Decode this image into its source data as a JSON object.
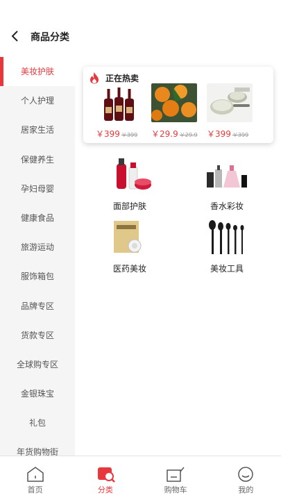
{
  "header": {
    "title": "商品分类",
    "back_icon": "chevron-left-icon"
  },
  "sidebar": {
    "active_index": 0,
    "items": [
      "美妆护肤",
      "个人护理",
      "居家生活",
      "保健养生",
      "孕妇母婴",
      "健康食品",
      "旅游运动",
      "服饰箱包",
      "品牌专区",
      "货款专区",
      "全球购专区",
      "金银珠宝",
      "礼包",
      "年货购物街"
    ]
  },
  "hot": {
    "title": "正在热卖",
    "icon": "flame-icon",
    "products": [
      {
        "price": "￥399",
        "old_price": "￥399",
        "image": "red-wine-bottles"
      },
      {
        "price": "￥29.9",
        "old_price": "￥29.9",
        "image": "oranges"
      },
      {
        "price": "￥399",
        "old_price": "￥399",
        "image": "cookware-set"
      }
    ]
  },
  "categories": [
    {
      "label": "面部护肤",
      "image": "skincare-bottles"
    },
    {
      "label": "香水彩妆",
      "image": "perfume-makeup"
    },
    {
      "label": "医药美妆",
      "image": "face-mask-pack"
    },
    {
      "label": "美妆工具",
      "image": "makeup-brushes"
    }
  ],
  "tabbar": {
    "active_index": 1,
    "items": [
      {
        "label": "首页",
        "icon": "home-icon"
      },
      {
        "label": "分类",
        "icon": "category-icon"
      },
      {
        "label": "购物车",
        "icon": "cart-icon"
      },
      {
        "label": "我的",
        "icon": "profile-icon"
      }
    ]
  },
  "colors": {
    "accent": "#e8383d",
    "sidebar_bg": "#f5f5f5"
  }
}
